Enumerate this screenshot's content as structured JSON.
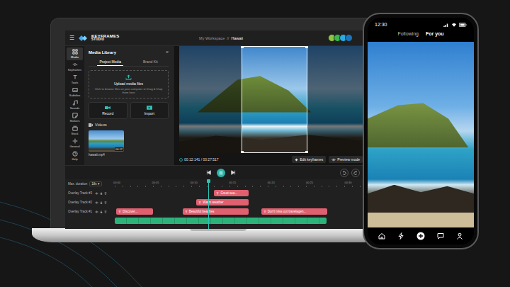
{
  "app": {
    "menu": "☰",
    "logo": [
      "KEYFRAMES",
      "STUDIO"
    ],
    "breadcrumb": [
      "My Workspace",
      "Hawaii"
    ],
    "separator": "//"
  },
  "collaborators": [
    {
      "color": "#8cc63f"
    },
    {
      "color": "#39b54a"
    },
    {
      "color": "#29abe2"
    },
    {
      "color": "#1b75bc"
    }
  ],
  "sidebar": {
    "items": [
      {
        "label": "Media",
        "selected": true
      },
      {
        "label": "Keyframes",
        "selected": false
      },
      {
        "label": "Tools",
        "selected": false
      },
      {
        "label": "Subtitles",
        "selected": false
      },
      {
        "label": "Sounds",
        "selected": false
      },
      {
        "label": "Stickers",
        "selected": false
      },
      {
        "label": "Stock",
        "selected": false
      },
      {
        "label": "General",
        "selected": false
      },
      {
        "label": "Help",
        "selected": false
      }
    ]
  },
  "media_library": {
    "title": "Media Library",
    "collapse": "«",
    "tabs": [
      {
        "label": "Project Media",
        "selected": true
      },
      {
        "label": "Brand Kit",
        "selected": false
      }
    ],
    "upload": {
      "title": "Upload media files",
      "hint": "Click to browse files on your computer or Drag & Drop them here"
    },
    "actions": [
      "Record",
      "Import"
    ],
    "section": "Videos",
    "files": [
      {
        "name": "hawaii.mp4",
        "duration": "00:12"
      }
    ]
  },
  "preview": {
    "time": "00:12:141 / 00:27:517",
    "buttons": [
      "Edit keyframes",
      "Preview mode"
    ]
  },
  "transport": {
    "playing": true
  },
  "timeline": {
    "duration_label": "Max. duration",
    "duration_value": "18s",
    "duration_caret": "▾",
    "ticks": [
      "00:00",
      "00:05",
      "00:10",
      "00:15",
      "00:20",
      "00:25",
      "00:30"
    ],
    "playhead_seconds": 12.141,
    "tracks": [
      {
        "name": "Overlay Track #3",
        "clips": [
          {
            "label": "Great sea...",
            "start": 12.9,
            "end": 17.4
          }
        ]
      },
      {
        "name": "Overlay Track #2",
        "clips": [
          {
            "label": "Warm weather",
            "start": 10.6,
            "end": 17.4
          }
        ]
      },
      {
        "name": "Overlay Track #1",
        "clips": [
          {
            "label": "Discover...",
            "start": 0.2,
            "end": 5.0
          },
          {
            "label": "Beautiful beaches",
            "start": 8.8,
            "end": 17.4
          },
          {
            "label": "Don't miss out travelagen...",
            "start": 19.0,
            "end": 27.6
          }
        ]
      }
    ],
    "video_track": {
      "start": 0,
      "end": 27.5
    }
  },
  "phone": {
    "time": "12:30",
    "tabs": [
      {
        "label": "Following",
        "selected": false
      },
      {
        "label": "For you",
        "selected": true
      }
    ]
  }
}
